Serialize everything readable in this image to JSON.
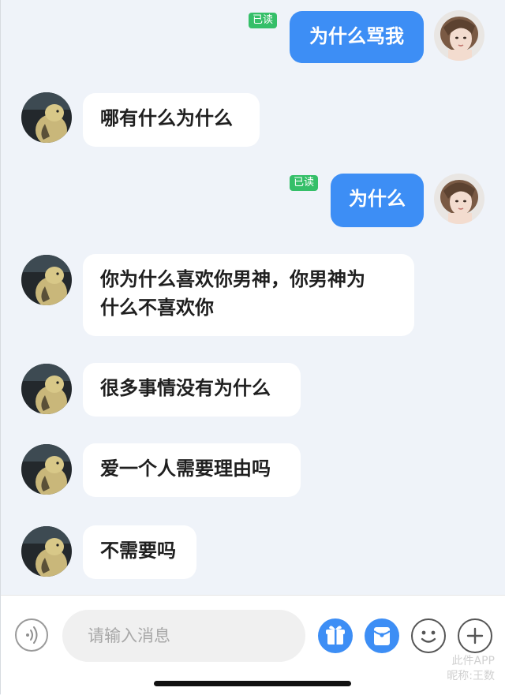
{
  "colors": {
    "background": "#eff3f9",
    "outgoing_bubble": "#3d8ef5",
    "incoming_bubble": "#ffffff",
    "read_badge": "#35bf69"
  },
  "messages": [
    {
      "direction": "out",
      "text": "为什么骂我",
      "status": "已读"
    },
    {
      "direction": "in",
      "text": "哪有什么为什么"
    },
    {
      "direction": "out",
      "text": "为什么",
      "status": "已读"
    },
    {
      "direction": "in",
      "text_line1": "你为什么喜欢你男神，你男神为",
      "text_line2": "什么不喜欢你"
    },
    {
      "direction": "in",
      "text": "很多事情没有为什么"
    },
    {
      "direction": "in",
      "text": "爱一个人需要理由吗"
    },
    {
      "direction": "in",
      "text": "不需要吗"
    }
  ],
  "input_bar": {
    "placeholder": "请输入消息",
    "icons": [
      "voice-icon",
      "gift-icon",
      "red-packet-icon",
      "emoji-icon",
      "plus-icon"
    ]
  },
  "watermark": {
    "line1": "此件APP",
    "line2": "昵称:王数"
  }
}
